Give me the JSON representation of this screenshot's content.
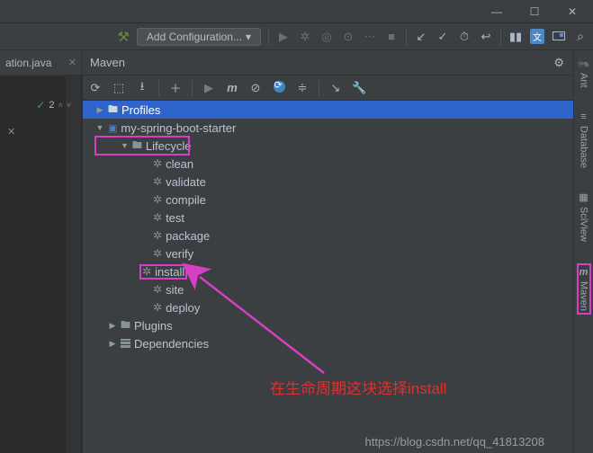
{
  "titlebar": {
    "min": "—",
    "max": "☐",
    "close": "✕"
  },
  "main_toolbar": {
    "add_config": "Add Configuration...",
    "chev": "▾"
  },
  "editor": {
    "tab_label": "ation.java",
    "badge_count": "2"
  },
  "maven": {
    "title": "Maven",
    "profiles_label": "Profiles",
    "project_label": "my-spring-boot-starter",
    "lifecycle_label": "Lifecycle",
    "goals": [
      "clean",
      "validate",
      "compile",
      "test",
      "package",
      "verify",
      "install",
      "site",
      "deploy"
    ],
    "plugins_label": "Plugins",
    "dependencies_label": "Dependencies"
  },
  "right_rail": {
    "ant": "Ant",
    "database": "Database",
    "sciview": "SciView",
    "maven": "Maven"
  },
  "annotation": {
    "text": "在生命周期这块选择install",
    "watermark": "https://blog.csdn.net/qq_41813208"
  }
}
